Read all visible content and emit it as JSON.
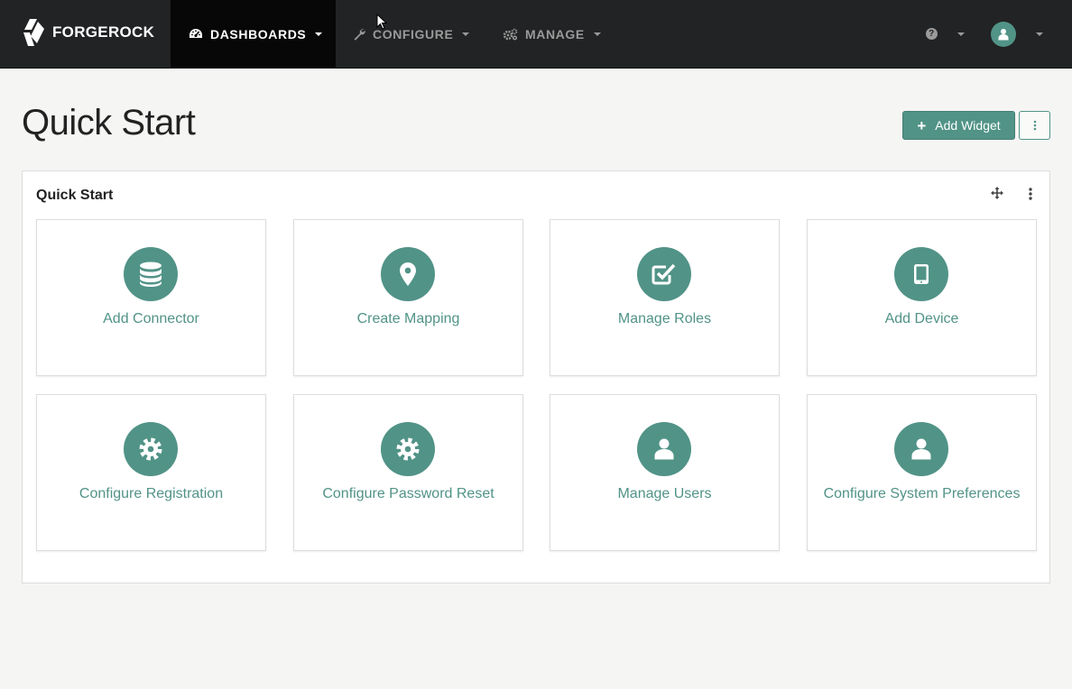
{
  "colors": {
    "accent": "#519387",
    "navbar": "#222324",
    "navbar_active": "#070707",
    "nav_text": "#9a9a9a",
    "background": "#f5f5f4"
  },
  "navbar": {
    "brand": "FORGEROCK",
    "items": [
      {
        "label": "DASHBOARDS",
        "icon": "dashboard-gauge-icon",
        "active": true
      },
      {
        "label": "CONFIGURE",
        "icon": "wrench-icon",
        "active": false
      },
      {
        "label": "MANAGE",
        "icon": "cogs-icon",
        "active": false
      }
    ],
    "help_icon": "question-circle-icon",
    "user_icon": "user-avatar-icon"
  },
  "page": {
    "title": "Quick Start",
    "add_widget_label": "Add Widget"
  },
  "widget": {
    "title": "Quick Start",
    "cards": [
      {
        "label": "Add Connector",
        "icon": "database-icon"
      },
      {
        "label": "Create Mapping",
        "icon": "map-marker-icon"
      },
      {
        "label": "Manage Roles",
        "icon": "check-square-icon"
      },
      {
        "label": "Add Device",
        "icon": "tablet-icon"
      },
      {
        "label": "Configure Registration",
        "icon": "gear-icon"
      },
      {
        "label": "Configure Password Reset",
        "icon": "gear-icon"
      },
      {
        "label": "Manage Users",
        "icon": "user-icon"
      },
      {
        "label": "Configure System Preferences",
        "icon": "user-icon"
      }
    ]
  }
}
